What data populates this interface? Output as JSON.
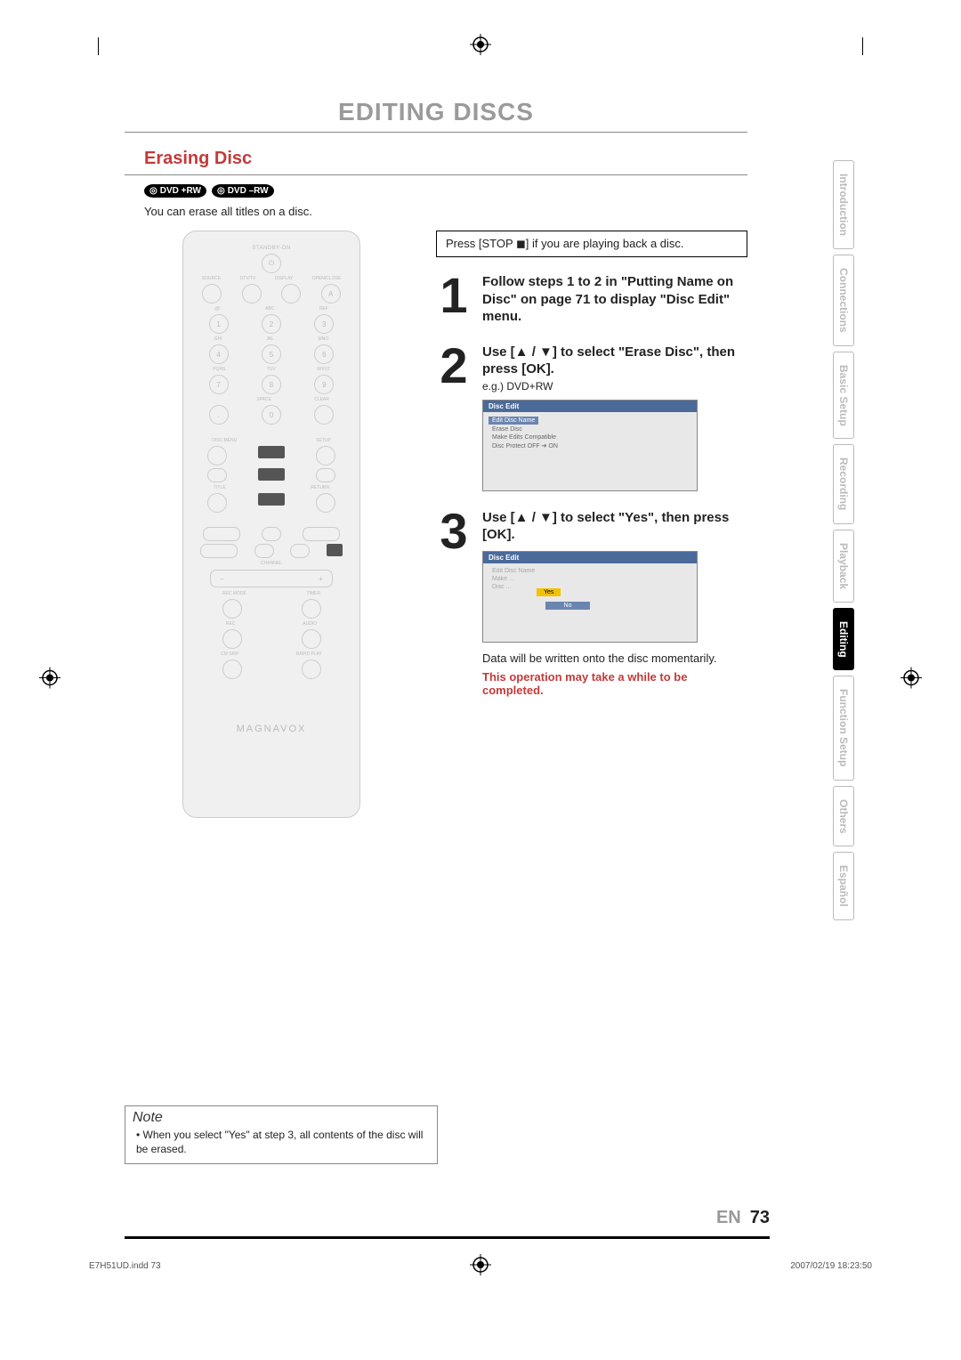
{
  "page_title": "EDITING DISCS",
  "section_heading": "Erasing Disc",
  "disc_badges": [
    "DVD +RW",
    "DVD –RW"
  ],
  "intro_line": "You can erase all titles on a disc.",
  "remote": {
    "top_label": "STANDBY-ON",
    "row1_labels": [
      "SOURCE",
      "DTV/TV",
      "DISPLAY",
      "OPEN/CLOSE"
    ],
    "numpad_labels_top": [
      "@!",
      "ABC",
      "DEF"
    ],
    "numpad_labels_mid": [
      "GHI",
      "JKL",
      "MNO"
    ],
    "numpad_labels_bot": [
      "PQRS",
      "TUV",
      "WXYZ"
    ],
    "space_clear": [
      "SPACE",
      "CLEAR"
    ],
    "disc_setup": [
      "DISC MENU",
      "SETUP"
    ],
    "title_return": [
      "TITLE",
      "RETURN"
    ],
    "channel": "CHANNEL",
    "rec_timer": [
      "REC MODE",
      "TIMER"
    ],
    "rec_audio": [
      "REC",
      "AUDIO"
    ],
    "cmskip_rapid": [
      "CM SKIP",
      "RAPID PLAY"
    ],
    "brand": "MAGNAVOX"
  },
  "prestep": "Press [STOP ◼] if you are playing back a disc.",
  "steps": [
    {
      "num": "1",
      "heading": "Follow steps 1 to 2 in \"Putting Name on Disc\" on page 71 to display \"Disc Edit\" menu."
    },
    {
      "num": "2",
      "heading": "Use [▲ / ▼] to select \"Erase Disc\", then press [OK].",
      "sub": "e.g.) DVD+RW",
      "screen": {
        "title": "Disc Edit",
        "items_hl": [
          "Edit Disc Name"
        ],
        "items_plain": [
          "Erase Disc",
          "Make Edits Compatible",
          "Disc Protect OFF ➔ ON"
        ]
      }
    },
    {
      "num": "3",
      "heading": "Use [▲ / ▼] to select \"Yes\", then press [OK].",
      "screen": {
        "title": "Disc Edit",
        "items_faded": [
          "Edit Disc Name",
          "Make ...",
          "Disc ..."
        ],
        "yes": "Yes",
        "no": "No"
      },
      "after": "Data will be written onto the disc momentarily.",
      "red": "This operation may take a while to be completed."
    }
  ],
  "note": {
    "title": "Note",
    "body": "• When you select \"Yes\" at step 3, all contents of the disc will be erased."
  },
  "side_tabs": [
    {
      "label": "Introduction",
      "active": false
    },
    {
      "label": "Connections",
      "active": false
    },
    {
      "label": "Basic Setup",
      "active": false
    },
    {
      "label": "Recording",
      "active": false
    },
    {
      "label": "Playback",
      "active": false
    },
    {
      "label": "Editing",
      "active": true
    },
    {
      "label": "Function Setup",
      "active": false
    },
    {
      "label": "Others",
      "active": false
    },
    {
      "label": "Español",
      "active": false
    }
  ],
  "page_footer": {
    "lang": "EN",
    "page": "73"
  },
  "print_footer": {
    "file": "E7H51UD.indd   73",
    "date": "2007/02/19   18:23:50"
  }
}
